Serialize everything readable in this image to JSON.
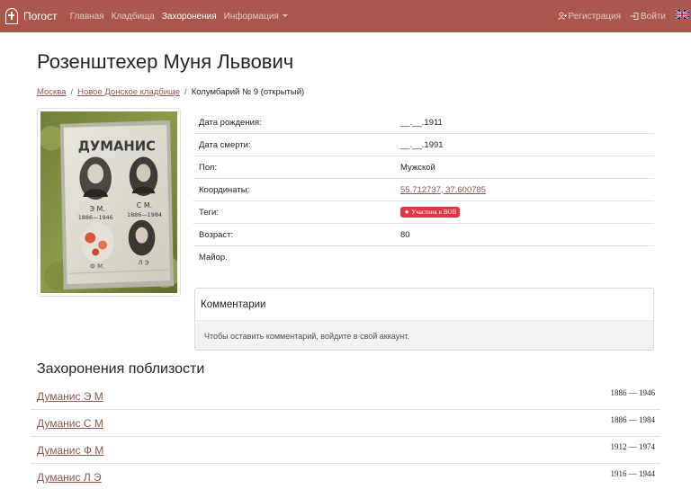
{
  "navbar": {
    "brand": "Погост",
    "links": [
      {
        "label": "Главная",
        "active": false
      },
      {
        "label": "Кладбища",
        "active": false
      },
      {
        "label": "Захоронения",
        "active": true
      },
      {
        "label": "Информация",
        "active": false
      }
    ],
    "register": "Регистрация",
    "login": "Войти",
    "language_icon": "uk-flag-icon"
  },
  "page": {
    "title": "Розенштехер Муня Львович"
  },
  "breadcrumb": [
    {
      "label": "Москва",
      "link": true
    },
    {
      "label": "Новое Донское кладбище",
      "link": true
    },
    {
      "label": "Колумбарий № 9 (открытый)",
      "link": false
    }
  ],
  "details": {
    "birth_label": "Дата рождения:",
    "birth_value": "__.__.1911",
    "death_label": "Дата смерти:",
    "death_value": "__.__.1991",
    "gender_label": "Пол:",
    "gender_value": "Мужской",
    "coords_label": "Координаты:",
    "coords_value": "55.712737, 37.600785",
    "tags_label": "Теги:",
    "tag": "Участник в ВОВ",
    "age_label": "Возраст:",
    "age_value": "80",
    "rank_label": "Майор."
  },
  "photo": {
    "inscription": "ДУМАНИС",
    "portraits": [
      {
        "initials": "Э М.",
        "years": "1886—1946"
      },
      {
        "initials": "С М.",
        "years": "1886—1984"
      },
      {
        "initials": "Ф М.",
        "years": ""
      },
      {
        "initials": "Л Э",
        "years": ""
      }
    ]
  },
  "comments": {
    "title": "Комментарии",
    "message": "Чтобы оставить комментарий, войдите в свой аккаунт."
  },
  "nearby": {
    "title": "Захоронения поблизости",
    "items": [
      {
        "name": "Думанис Э М",
        "years": "1886 — 1946"
      },
      {
        "name": "Думанис С М",
        "years": "1886 — 1984"
      },
      {
        "name": "Думанис Ф М",
        "years": "1912 — 1974"
      },
      {
        "name": "Думанис Л Э",
        "years": "1916 — 1944"
      }
    ]
  },
  "colors": {
    "navbar": "#a9574a",
    "link": "#8a5a4e",
    "badge": "#dc3545"
  }
}
